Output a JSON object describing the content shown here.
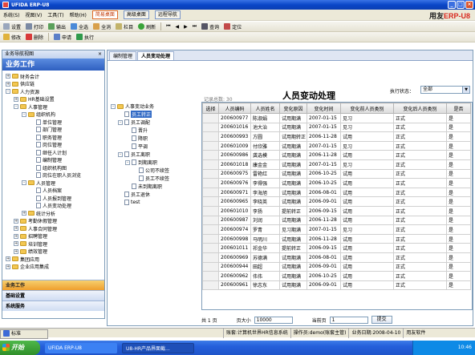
{
  "window": {
    "title": "UFIDA ERP-U8",
    "brand_prefix": "用友",
    "brand_suffix": "ERP-U8"
  },
  "menu": [
    "系统(S)",
    "视图(V)",
    "工具(T)",
    "帮助(H)"
  ],
  "desk_tabs": [
    {
      "label": "简易桌面",
      "active": true
    },
    {
      "label": "高级桌面",
      "active": false
    },
    {
      "label": "远程导航",
      "active": false
    }
  ],
  "toolbar1": [
    "设置",
    "打印",
    "输出",
    "全选",
    "全消",
    "栏目",
    "刷新",
    "查询",
    "定位"
  ],
  "toolbar2": [
    "修改",
    "删除",
    "申请",
    "执行"
  ],
  "nav": {
    "header": "业务导航视图",
    "close": "×",
    "title": "业务工作",
    "tree": [
      {
        "label": "财务会计",
        "lvl": 0,
        "exp": "+",
        "icon": "fold"
      },
      {
        "label": "供应链",
        "lvl": 0,
        "exp": "+",
        "icon": "fold"
      },
      {
        "label": "人力资源",
        "lvl": 0,
        "exp": "-",
        "icon": "fold"
      },
      {
        "label": "HR基础设置",
        "lvl": 1,
        "exp": "+",
        "icon": "fold"
      },
      {
        "label": "人事管理",
        "lvl": 1,
        "exp": "-",
        "icon": "fold"
      },
      {
        "label": "组织机构",
        "lvl": 2,
        "exp": "-",
        "icon": "fold"
      },
      {
        "label": "单位管理",
        "lvl": 3,
        "exp": "",
        "icon": "doc"
      },
      {
        "label": "部门管理",
        "lvl": 3,
        "exp": "",
        "icon": "doc"
      },
      {
        "label": "职务管理",
        "lvl": 3,
        "exp": "",
        "icon": "doc"
      },
      {
        "label": "岗位管理",
        "lvl": 3,
        "exp": "",
        "icon": "doc"
      },
      {
        "label": "继任人计划",
        "lvl": 3,
        "exp": "",
        "icon": "doc"
      },
      {
        "label": "编制管理",
        "lvl": 3,
        "exp": "",
        "icon": "doc"
      },
      {
        "label": "组织机构图",
        "lvl": 3,
        "exp": "",
        "icon": "doc"
      },
      {
        "label": "岗位在职人员浏览",
        "lvl": 3,
        "exp": "",
        "icon": "doc"
      },
      {
        "label": "人员管理",
        "lvl": 2,
        "exp": "-",
        "icon": "fold"
      },
      {
        "label": "人员档案",
        "lvl": 3,
        "exp": "",
        "icon": "doc"
      },
      {
        "label": "人员报到管理",
        "lvl": 3,
        "exp": "",
        "icon": "doc"
      },
      {
        "label": "人员变动处理",
        "lvl": 3,
        "exp": "",
        "icon": "doc"
      },
      {
        "label": "统计分析",
        "lvl": 2,
        "exp": "+",
        "icon": "fold"
      },
      {
        "label": "考勤休假管理",
        "lvl": 1,
        "exp": "+",
        "icon": "fold"
      },
      {
        "label": "人事合同管理",
        "lvl": 1,
        "exp": "+",
        "icon": "fold"
      },
      {
        "label": "招聘管理",
        "lvl": 1,
        "exp": "+",
        "icon": "fold"
      },
      {
        "label": "培训管理",
        "lvl": 1,
        "exp": "+",
        "icon": "fold"
      },
      {
        "label": "绩效管理",
        "lvl": 1,
        "exp": "+",
        "icon": "fold"
      },
      {
        "label": "集团应用",
        "lvl": 0,
        "exp": "+",
        "icon": "fold"
      },
      {
        "label": "企业应用集成",
        "lvl": 0,
        "exp": "+",
        "icon": "fold"
      }
    ],
    "sections": [
      "业务工作",
      "基础设置",
      "系统服务"
    ]
  },
  "tabs": [
    {
      "label": "编制管理",
      "active": false
    },
    {
      "label": "人员变动处理",
      "active": true
    }
  ],
  "page": {
    "title": "人员变动处理",
    "record_count": "记录总数: 30",
    "exec_label": "执行状态：",
    "exec_value": "全部"
  },
  "subtree": [
    {
      "label": "人事变动业务",
      "lvl": 0,
      "exp": "-"
    },
    {
      "label": "员工转正",
      "lvl": 1,
      "exp": "",
      "sel": true
    },
    {
      "label": "员工调配",
      "lvl": 1,
      "exp": "-"
    },
    {
      "label": "晋升",
      "lvl": 2,
      "exp": ""
    },
    {
      "label": "降职",
      "lvl": 2,
      "exp": ""
    },
    {
      "label": "平调",
      "lvl": 2,
      "exp": ""
    },
    {
      "label": "员工离职",
      "lvl": 1,
      "exp": "-"
    },
    {
      "label": "到期离职",
      "lvl": 2,
      "exp": "-"
    },
    {
      "label": "公司不续签",
      "lvl": 3,
      "exp": ""
    },
    {
      "label": "员工不续签",
      "lvl": 3,
      "exp": ""
    },
    {
      "label": "未到期离职",
      "lvl": 2,
      "exp": ""
    },
    {
      "label": "员工退休",
      "lvl": 1,
      "exp": ""
    },
    {
      "label": "test",
      "lvl": 1,
      "exp": ""
    }
  ],
  "grid": {
    "columns": [
      "选择",
      "人员编码",
      "人员姓名",
      "变化原因",
      "变化时间",
      "变化前人员类别",
      "变化后人员类别",
      "是否"
    ],
    "rows": [
      [
        "",
        "200600977",
        "陈淑娟",
        "试用期满",
        "2007-01-15",
        "见习",
        "正式",
        "是"
      ],
      [
        "",
        "200601016",
        "池大治",
        "试用期满",
        "2007-01-15",
        "见习",
        "正式",
        "是"
      ],
      [
        "",
        "200600993",
        "方圆",
        "试用期转正",
        "2006-11-28",
        "试用",
        "正式",
        "是"
      ],
      [
        "",
        "200601009",
        "付欣雅",
        "试用期满",
        "2007-01-15",
        "见习",
        "正式",
        "是"
      ],
      [
        "",
        "200600986",
        "龚选模",
        "试用期满",
        "2006-11-28",
        "试用",
        "正式",
        "是"
      ],
      [
        "",
        "200601018",
        "康金金",
        "试用期满",
        "2007-01-15",
        "见习",
        "正式",
        "是"
      ],
      [
        "",
        "200600975",
        "雷艳红",
        "试用期满",
        "2006-10-25",
        "试用",
        "正式",
        "是"
      ],
      [
        "",
        "200600976",
        "李得强",
        "试用期满",
        "2006-10-25",
        "试用",
        "正式",
        "是"
      ],
      [
        "",
        "200600971",
        "李海旭",
        "试用期满",
        "2006-08-01",
        "试用",
        "正式",
        "是"
      ],
      [
        "",
        "200600965",
        "李晓英",
        "试用期满",
        "2006-09-01",
        "试用",
        "正式",
        "是"
      ],
      [
        "",
        "200601010",
        "李扬",
        "提前转正",
        "2006-09-15",
        "试用",
        "正式",
        "是"
      ],
      [
        "",
        "200600987",
        "刘润",
        "试用期满",
        "2006-11-28",
        "试用",
        "正式",
        "是"
      ],
      [
        "",
        "200600974",
        "罗青",
        "见习期满",
        "2007-01-15",
        "见习",
        "正式",
        "是"
      ],
      [
        "",
        "200600998",
        "马明川",
        "试用期满",
        "2006-11-28",
        "试用",
        "正式",
        "是"
      ],
      [
        "",
        "200601011",
        "祁金华",
        "提前转正",
        "2006-09-15",
        "试用",
        "正式",
        "是"
      ],
      [
        "",
        "200600969",
        "苏德满",
        "试用期满",
        "2006-08-01",
        "试用",
        "正式",
        "是"
      ],
      [
        "",
        "200600944",
        "田超",
        "试用期满",
        "2006-09-01",
        "试用",
        "正式",
        "是"
      ],
      [
        "",
        "200600962",
        "伟伟",
        "试用期满",
        "2006-10-25",
        "试用",
        "正式",
        "是"
      ],
      [
        "",
        "200600961",
        "徐志东",
        "试用期满",
        "2006-09-01",
        "试用",
        "正式",
        "是"
      ]
    ]
  },
  "footer": {
    "total": "共 1 页",
    "page_size_label": "页大小",
    "page_size": "10000",
    "current_label": "当前页",
    "current": "1",
    "submit": "提交"
  },
  "status": {
    "ime": "标准",
    "account": "账套:计算机世界HR信息系统",
    "operator": "操作员:demo(账套主管)",
    "business_date": "业务日期:2008-04-10",
    "right": "用友软件"
  },
  "taskbar": {
    "start": "开始",
    "tasks": [
      "UFIDA ERP-U8",
      "U8-HR产品界面截..."
    ],
    "clock": "10:46"
  }
}
